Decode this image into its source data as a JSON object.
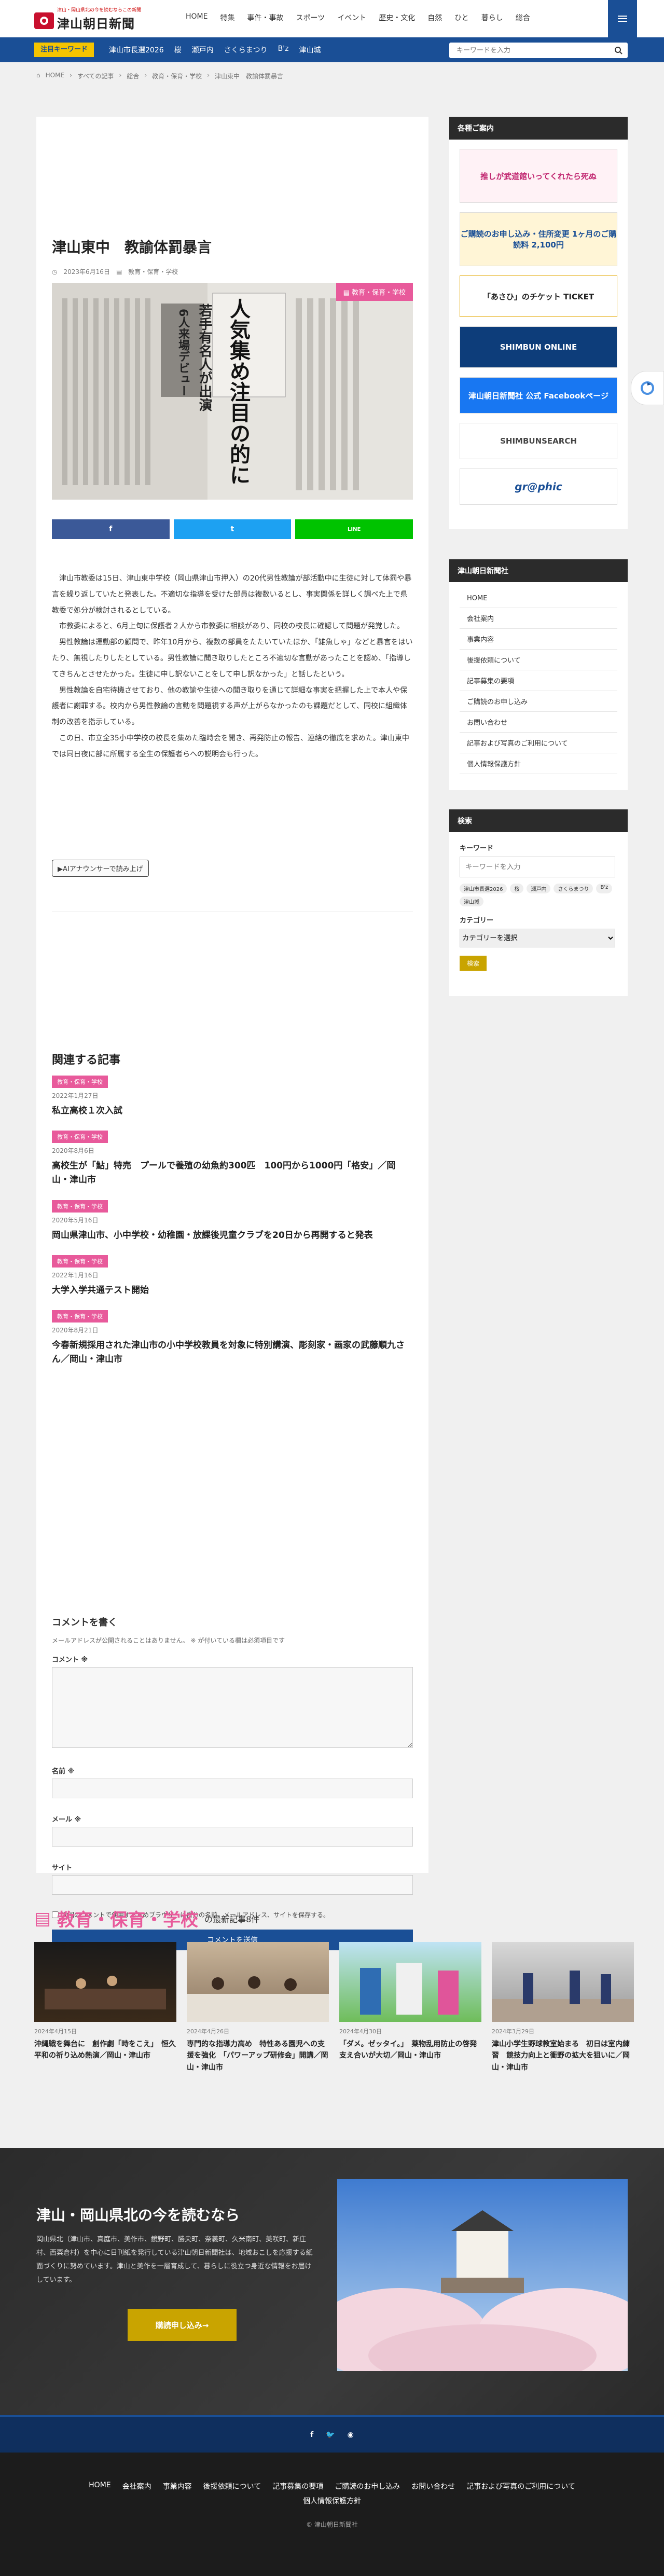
{
  "header": {
    "tagline": "津山・岡山県北の今を読むならこの新聞",
    "logo_text": "津山朝日新聞",
    "nav": [
      "HOME",
      "特集",
      "事件・事故",
      "スポーツ",
      "イベント",
      "歴史・文化",
      "自然",
      "ひと",
      "暮らし",
      "総合"
    ]
  },
  "trend": {
    "label": "注目キーワード",
    "items": [
      "津山市長選2026",
      "桜",
      "瀬戸内",
      "さくらまつり",
      "B'z",
      "津山城"
    ],
    "search_placeholder": "キーワードを入力"
  },
  "breadcrumb": [
    "HOME",
    "すべての記事",
    "総合",
    "教育・保育・学校",
    "津山東中　教諭体罰暴言"
  ],
  "article": {
    "title": "津山東中　教諭体罰暴言",
    "date": "2023年6月16日",
    "category": "教育・保育・学校",
    "hero_category": "教育・保育・学校",
    "hero_text": [
      "人気集め注目の的に",
      "若手有名人が出演",
      "6人来場デビュー"
    ],
    "paragraphs": [
      "津山市教委は15日、津山東中学校（岡山県津山市押入）の20代男性教論が部活動中に生徒に対して体罰や暴言を繰り返していたと発表した。不適切な指導を受けた部員は複数いるとし、事実関係を詳しく調べた上で県教委で処分が検討されるとしている。",
      "市教委によると、6月上旬に保護者２人から市教委に相談があり、同校の校長に確認して問題が発覚した。",
      "男性教論は運動部の顧問で、昨年10月から、複数の部員をたたいていたほか、「雑魚しゃ」などと暴言をはいたり、無視したりしたとしている。男性教論に聞き取りしたところ不適切な言動があったことを認め、「指導してきちんとさせたかった。生徒に申し訳ないことをして申し訳なかった」と話したという。",
      "男性教論を自宅待機させており、他の教諭や生徒への聞き取りを通じて詳細な事実を把握した上で本人や保護者に謝罪する。校内から男性教論の言動を問題視する声が上がらなかったのも課題だとして、同校に組織体制の改善を指示している。",
      "この日、市立全35小中学校の校長を集めた臨時会を開き、再発防止の報告、連絡の徹底を求めた。津山東中では同日夜に部に所属する全生の保護者らへの説明会も行った。"
    ],
    "ai_button": "▶AIアナウンサーで読み上げ"
  },
  "share": {
    "facebook": "f",
    "twitter": "t",
    "line": "LINE",
    "colors": {
      "facebook": "#3b5998",
      "twitter": "#1da1f2",
      "line": "#00c300"
    }
  },
  "related": {
    "title": "関連する記事",
    "items": [
      {
        "cat": "教育・保育・学校",
        "date": "2022年1月27日",
        "title": "私立高校１次入試"
      },
      {
        "cat": "教育・保育・学校",
        "date": "2020年8月6日",
        "title": "高校生が「鮎」特売　プールで養殖の幼魚約300匹　100円から1000円「格安」／岡山・津山市"
      },
      {
        "cat": "教育・保育・学校",
        "date": "2020年5月16日",
        "title": "岡山県津山市、小中学校・幼稚園・放課後児童クラブを20日から再開すると発表"
      },
      {
        "cat": "教育・保育・学校",
        "date": "2022年1月16日",
        "title": "大学入学共通テスト開始"
      },
      {
        "cat": "教育・保育・学校",
        "date": "2020年8月21日",
        "title": "今春新規採用された津山市の小中学校教員を対象に特別講演、彫刻家・画家の武藤順九さん／岡山・津山市"
      }
    ]
  },
  "comment": {
    "title": "コメントを書く",
    "note": "メールアドレスが公開されることはありません。 ※ が付いている欄は必須項目です",
    "label_comment": "コメント ※",
    "label_name": "名前 ※",
    "label_email": "メール ※",
    "label_site": "サイト",
    "cookie": "次回のコメントで使用するためブラウザーに自分の名前、メールアドレス、サイトを保存する。",
    "submit": "コメントを送信"
  },
  "sidebar": {
    "guide_title": "各種ご案内",
    "banners": [
      "推しが武道館いってくれたら死ぬ",
      "ご購読のお申し込み・住所変更 1ヶ月のご購読料 2,100円",
      "「あさひ」のチケット TICKET",
      "SHIMBUN ONLINE",
      "津山朝日新聞社 公式 Facebookページ",
      "SHIMBUNSEARCH",
      "gr@phic"
    ],
    "company_title": "津山朝日新聞社",
    "company_links": [
      "HOME",
      "会社案内",
      "事業内容",
      "後援依頼について",
      "記事募集の要項",
      "ご購読のお申し込み",
      "お問い合わせ",
      "記事および写真のご利用について",
      "個人情報保護方針"
    ],
    "search_title": "検索",
    "search_keyword": "キーワード",
    "search_placeholder": "キーワードを入力",
    "search_tags": [
      "津山市長選2026",
      "桜",
      "瀬戸内",
      "さくらまつり",
      "B'z",
      "津山城"
    ],
    "category_label": "カテゴリー",
    "category_select": "カテゴリーを選択",
    "search_button": "検索"
  },
  "category_section": {
    "title": "教育・保育・学校",
    "subtitle": "の最新記事8件",
    "cards": [
      {
        "date": "2024年4月15日",
        "title": "沖縄戦を舞台に　創作劇「時をこえ」　恒久平和の祈り込め熱演／岡山・津山市"
      },
      {
        "date": "2024年4月26日",
        "title": "専門的な指導力高め　特性ある園児への支援を強化　「パワーアップ研修会」開講／岡山・津山市"
      },
      {
        "date": "2024年4月30日",
        "title": "「ダメ。ゼッタイ。」　薬物乱用防止の啓発　支え合いが大切／岡山・津山市"
      },
      {
        "date": "2024年3月29日",
        "title": "津山小学生野球教室始まる　初日は室内練習　競技力向上と衝野の拡大を狙いに／岡山・津山市"
      }
    ]
  },
  "promo": {
    "title": "津山・岡山県北の今を読むなら",
    "text": "岡山県北（津山市、真庭市、美作市、鏡野町、勝央町、奈義町、久米南町、美咲町、新庄村、西粟倉村）を中心に日刊紙を発行している津山朝日新聞社は、地域おこしを応援する紙面づくりに努めています。津山と美作を一層育成して、暮らしに役立つ身近な情報をお届けしています。",
    "button": "購読申し込み→"
  },
  "footer": {
    "links": [
      "HOME",
      "会社案内",
      "事業内容",
      "後援依頼について",
      "記事募集の要項",
      "ご購読のお申し込み",
      "お問い合わせ",
      "記事および写真のご利用について",
      "個人情報保護方針"
    ],
    "copyright": "© 津山朝日新聞社"
  }
}
